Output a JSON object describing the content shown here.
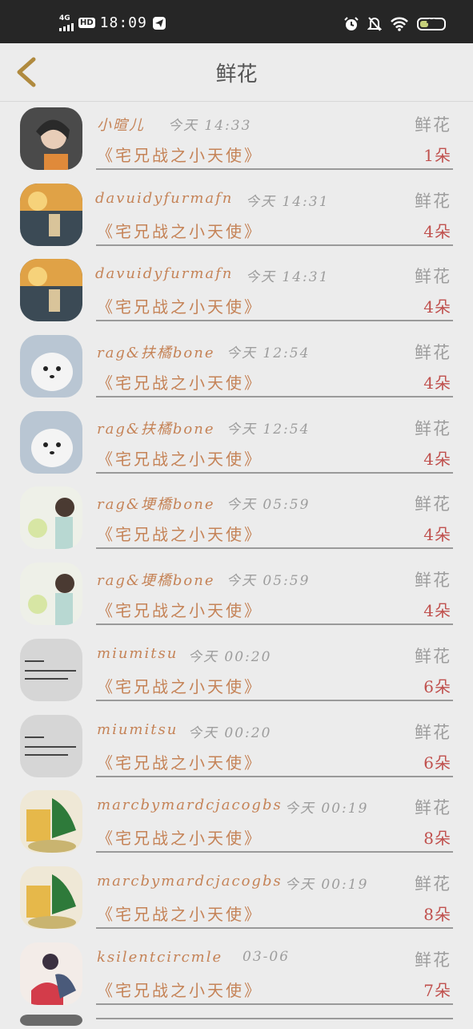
{
  "status_bar": {
    "signal": "4G",
    "hd": "HD",
    "time": "18:09",
    "battery": "48"
  },
  "header": {
    "title": "鲜花"
  },
  "rows": [
    {
      "username": "小暄儿",
      "time": "今天 14:33",
      "gift": "鲜花",
      "book": "《宅兄战之小天使》",
      "count": "1朵",
      "avatar": "avatar-girl-portrait"
    },
    {
      "username": "davuidyfurmafn",
      "time": "今天 14:31",
      "gift": "鲜花",
      "book": "《宅兄战之小天使》",
      "count": "4朵",
      "avatar": "avatar-sunset-photo"
    },
    {
      "username": "davuidyfurmafn",
      "time": "今天 14:31",
      "gift": "鲜花",
      "book": "《宅兄战之小天使》",
      "count": "4朵",
      "avatar": "avatar-sunset-photo"
    },
    {
      "username": "rag&扶橘bone",
      "time": "今天 12:54",
      "gift": "鲜花",
      "book": "《宅兄战之小天使》",
      "count": "4朵",
      "avatar": "avatar-white-dog"
    },
    {
      "username": "rag&扶橘bone",
      "time": "今天 12:54",
      "gift": "鲜花",
      "book": "《宅兄战之小天使》",
      "count": "4朵",
      "avatar": "avatar-white-dog"
    },
    {
      "username": "rag&埂橋bone",
      "time": "今天 05:59",
      "gift": "鲜花",
      "book": "《宅兄战之小天使》",
      "count": "4朵",
      "avatar": "avatar-girl-flowers"
    },
    {
      "username": "rag&埂橋bone",
      "time": "今天 05:59",
      "gift": "鲜花",
      "book": "《宅兄战之小天使》",
      "count": "4朵",
      "avatar": "avatar-girl-flowers"
    },
    {
      "username": "miumitsu",
      "time": "今天 00:20",
      "gift": "鲜花",
      "book": "《宅兄战之小天使》",
      "count": "6朵",
      "avatar": "avatar-handwriting"
    },
    {
      "username": "miumitsu",
      "time": "今天 00:20",
      "gift": "鲜花",
      "book": "《宅兄战之小天使》",
      "count": "6朵",
      "avatar": "avatar-handwriting"
    },
    {
      "username": "marcbymardcjacogbs",
      "time": "今天 00:19",
      "gift": "鲜花",
      "book": "《宅兄战之小天使》",
      "count": "8朵",
      "avatar": "avatar-plant-book"
    },
    {
      "username": "marcbymardcjacogbs",
      "time": "今天 00:19",
      "gift": "鲜花",
      "book": "《宅兄战之小天使》",
      "count": "8朵",
      "avatar": "avatar-plant-book"
    },
    {
      "username": "ksilentcircmle",
      "time": "03-06",
      "gift": "鲜花",
      "book": "《宅兄战之小天使》",
      "count": "7朵",
      "avatar": "avatar-anime-couple"
    }
  ],
  "colors": {
    "accent_text": "#c58357",
    "count_text": "#c0514e",
    "muted_text": "#9d9d9d",
    "back_arrow": "#b08a3e"
  }
}
